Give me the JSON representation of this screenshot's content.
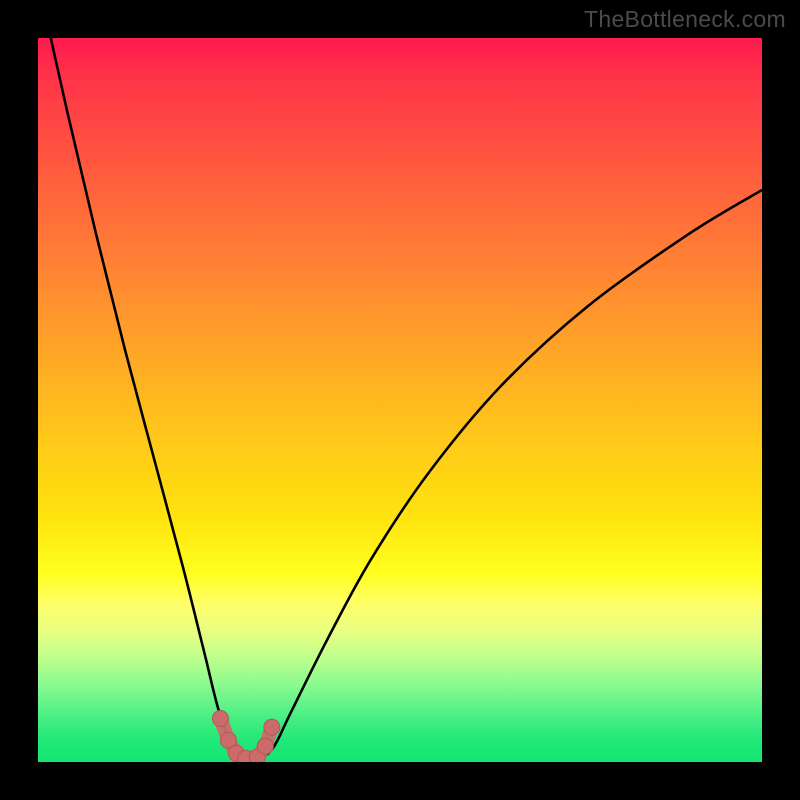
{
  "watermark": "TheBottleneck.com",
  "colors": {
    "gradient_top": "#FF1A4E",
    "gradient_mid": "#FFC41B",
    "gradient_bottom": "#12E573",
    "curve": "#000000",
    "marker_fill": "#CC6B6B",
    "marker_stroke": "#B85555"
  },
  "chart_data": {
    "type": "line",
    "title": "",
    "xlabel": "",
    "ylabel": "",
    "xlim": [
      0,
      100
    ],
    "ylim": [
      0,
      100
    ],
    "series": [
      {
        "name": "bottleneck-curve",
        "x": [
          0,
          4,
          8,
          12,
          16,
          20,
          23,
          25,
          27,
          29,
          30.5,
          32.5,
          35,
          40,
          46,
          54,
          64,
          76,
          90,
          100
        ],
        "y": [
          108,
          90,
          73,
          57,
          42,
          27,
          15,
          7,
          2,
          0.5,
          0.5,
          2,
          7,
          17,
          28,
          40,
          52,
          63,
          73,
          79
        ]
      }
    ],
    "markers": {
      "name": "bottom-highlight",
      "x": [
        25.2,
        26.3,
        27.4,
        28.7,
        30.3,
        31.4,
        32.3
      ],
      "y": [
        6.0,
        3.0,
        1.2,
        0.5,
        0.7,
        2.2,
        4.8
      ]
    }
  }
}
